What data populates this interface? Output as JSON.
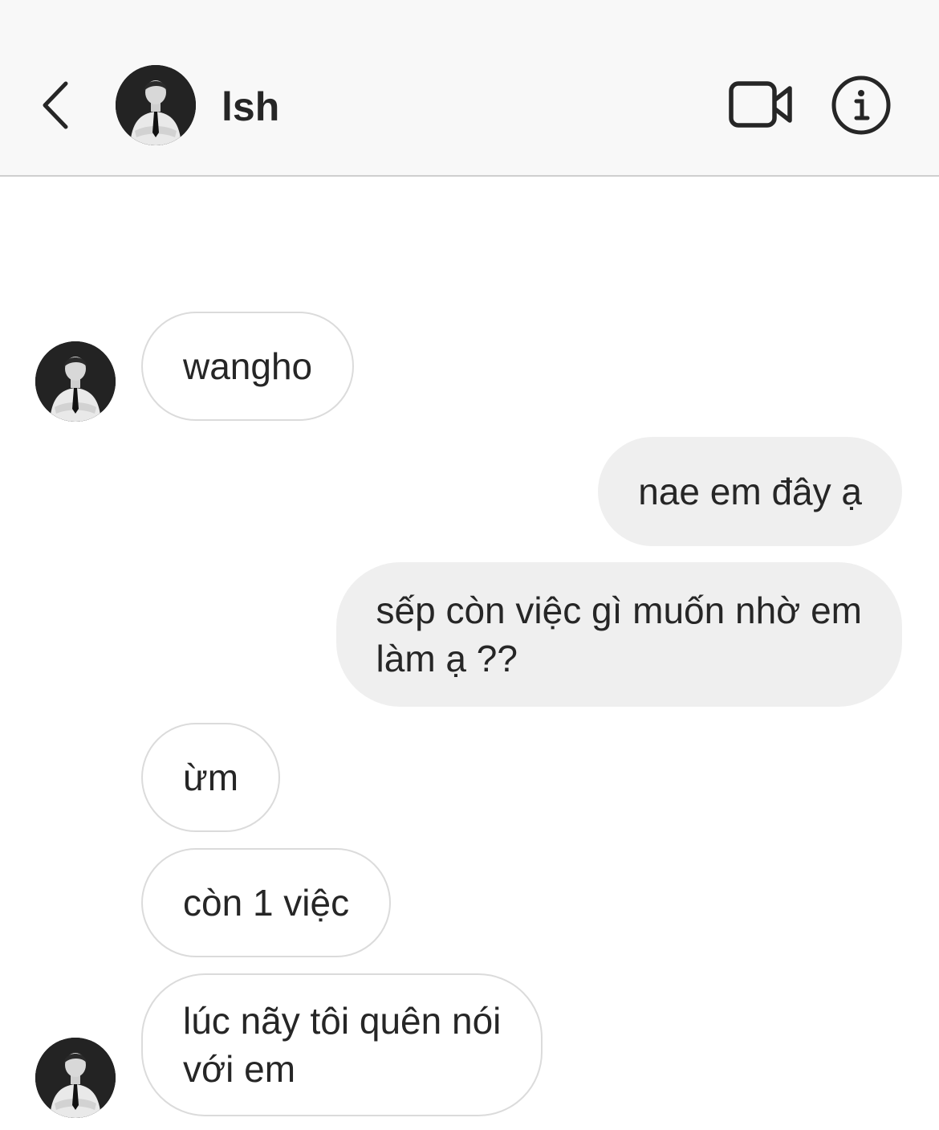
{
  "header": {
    "contact_name": "lsh",
    "back_icon": "chevron-left-icon",
    "video_icon": "video-camera-icon",
    "info_icon": "info-icon"
  },
  "messages": [
    {
      "sender": "them",
      "lines": [
        "wangho"
      ]
    },
    {
      "sender": "me",
      "lines": [
        "nae em đây ạ"
      ]
    },
    {
      "sender": "me",
      "lines": [
        "sếp còn việc gì muốn nhờ em",
        "làm ạ ??"
      ]
    },
    {
      "sender": "them",
      "lines": [
        "ừm"
      ]
    },
    {
      "sender": "them",
      "lines": [
        "còn 1 việc"
      ]
    },
    {
      "sender": "them",
      "lines": [
        "lúc nãy tôi quên nói",
        "với em"
      ]
    }
  ]
}
